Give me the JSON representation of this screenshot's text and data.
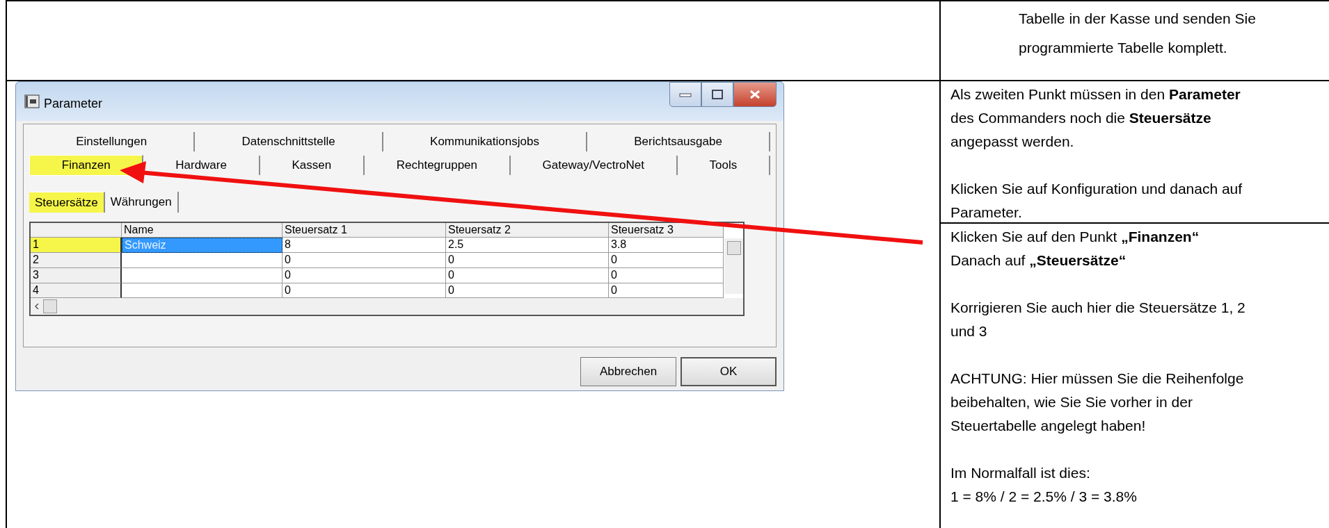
{
  "document": {
    "top_note": {
      "lines": [
        "Tabelle in der Kasse und senden Sie",
        "programmierte Tabelle komplett."
      ]
    },
    "step_intro": [
      {
        "lines": [
          "Als zweiten Punkt müssen in den **Parameter**",
          "des Commanders noch die **Steuersätze**",
          "angepasst werden."
        ]
      },
      {
        "lines": [
          "Klicken Sie auf Konfiguration und danach auf",
          "Parameter."
        ]
      }
    ],
    "step_details": [
      {
        "lines": [
          "Klicken Sie auf den Punkt **„Finanzen“**",
          "Danach auf **„Steuersätze“**"
        ]
      },
      {
        "lines": [
          "Korrigieren Sie auch hier die Steuersätze 1, 2",
          "und 3"
        ]
      },
      {
        "lines": [
          "ACHTUNG: Hier müssen Sie die Reihenfolge",
          "beibehalten, wie Sie Sie vorher in der",
          "Steuertabelle angelegt haben!"
        ]
      },
      {
        "lines": [
          "Im Normalfall ist dies:",
          " 1 = 8% / 2 = 2.5% / 3 = 3.8%"
        ]
      }
    ]
  },
  "dialog": {
    "title": "Parameter",
    "tab_rows": [
      {
        "tabs": [
          {
            "label": "Einstellungen",
            "selected": false,
            "highlighted": false
          },
          {
            "label": "Datenschnittstelle",
            "selected": false,
            "highlighted": false
          },
          {
            "label": "Kommunikationsjobs",
            "selected": false,
            "highlighted": false
          },
          {
            "label": "Berichtsausgabe",
            "selected": false,
            "highlighted": false
          }
        ]
      },
      {
        "tabs": [
          {
            "label": "Finanzen",
            "selected": true,
            "highlighted": true
          },
          {
            "label": "Hardware",
            "selected": false,
            "highlighted": false
          },
          {
            "label": "Kassen",
            "selected": false,
            "highlighted": false
          },
          {
            "label": "Rechtegruppen",
            "selected": false,
            "highlighted": false
          },
          {
            "label": "Gateway/VectroNet",
            "selected": false,
            "highlighted": false
          },
          {
            "label": "Tools",
            "selected": false,
            "highlighted": false
          }
        ]
      }
    ],
    "subtabs": [
      {
        "label": "Steuersätze",
        "selected": true,
        "highlighted": true
      },
      {
        "label": "Währungen",
        "selected": false,
        "highlighted": false
      }
    ],
    "table": {
      "columns": [
        "Name",
        "Steuersatz 1",
        "Steuersatz 2",
        "Steuersatz 3"
      ],
      "rows": [
        {
          "header": "1",
          "highlighted": true,
          "cells": [
            {
              "text": "Schweiz",
              "selected": true
            },
            {
              "text": "8",
              "selected": false
            },
            {
              "text": "2.5",
              "selected": false
            },
            {
              "text": "3.8",
              "selected": false
            }
          ]
        },
        {
          "header": "2",
          "highlighted": false,
          "cells": [
            {
              "selected": false
            },
            {
              "text": "0",
              "selected": false
            },
            {
              "text": "0",
              "selected": false
            },
            {
              "text": "0",
              "selected": false
            }
          ]
        },
        {
          "header": "3",
          "highlighted": false,
          "cells": [
            {
              "selected": false
            },
            {
              "text": "0",
              "selected": false
            },
            {
              "text": "0",
              "selected": false
            },
            {
              "text": "0",
              "selected": false
            }
          ]
        },
        {
          "header": "4",
          "highlighted": false,
          "cells": [
            {
              "selected": false
            },
            {
              "text": "0",
              "selected": false
            },
            {
              "text": "0",
              "selected": false
            },
            {
              "text": "0",
              "selected": false
            }
          ]
        }
      ]
    },
    "buttons": [
      "Abbrechen",
      "OK"
    ]
  }
}
